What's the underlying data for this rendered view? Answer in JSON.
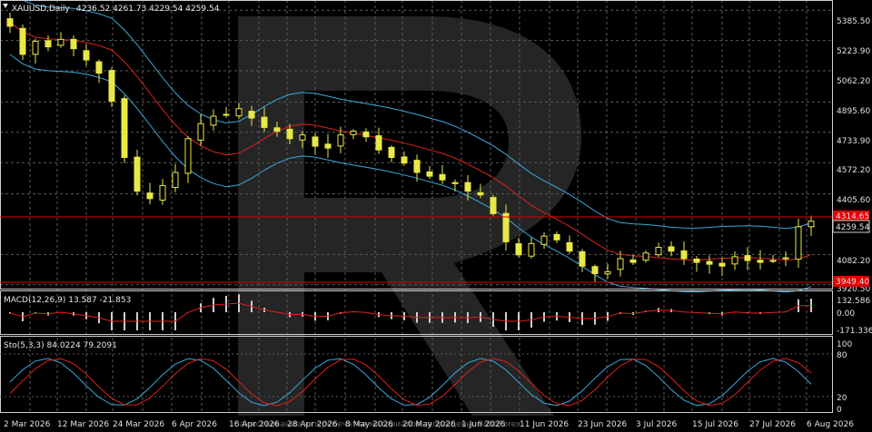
{
  "header": {
    "symbol_label": "XAUUSD,Daily",
    "ohlc": "4236.52 4261.73 4229.54 4259.54"
  },
  "colors": {
    "background": "#000000",
    "grid": "#5a5a5a",
    "bull_candle": "#000000",
    "candle": "#e8e848",
    "bollinger": "#3aa9d9",
    "ma": "#e02020",
    "hline": "#e00000",
    "macd_hist": "#cfcfcf",
    "macd_signal": "#e02020",
    "stoch_main": "#3aa9d9",
    "stoch_signal": "#e02020"
  },
  "price_panel": {
    "y_labels": [
      "5385.50",
      "5223.90",
      "5062.20",
      "4895.60",
      "4733.90",
      "4572.20",
      "4405.60",
      "4259.54",
      "4082.20",
      "3920.50"
    ],
    "current_price": "4259.54",
    "hline_upper": "4314.65",
    "hline_lower": "3949.40"
  },
  "macd_panel": {
    "label": "MACD(12,26,9) 13.587 -21.853",
    "y_labels": [
      "132.586",
      "0.00",
      "-171.336"
    ]
  },
  "stoch_panel": {
    "label": "Sto(5,3,3) 84.0224 79.2091",
    "y_labels": [
      "100",
      "80",
      "20",
      "0"
    ]
  },
  "x_axis": {
    "labels": [
      "2 Mar 2026",
      "12 Mar 2026",
      "24 Mar 2026",
      "6 Apr 2026",
      "16 Apr 2026",
      "28 Apr 2026",
      "8 May 2026",
      "20 May 2026",
      "1 Jun 2026",
      "11 Jun 2026",
      "23 Jun 2026",
      "3 Jul 2026",
      "15 Jul 2026",
      "27 Jul 2026",
      "6 Aug 2026"
    ]
  },
  "watermark": {
    "letter": "R",
    "footer_text": "Заимствование и перепечатка материалов запрещены. RoboForex"
  },
  "chart_data": {
    "type": "candlestick",
    "series": [
      {
        "name": "XAUUSD,Daily",
        "close_path": [
          5300,
          5150,
          5220,
          5190,
          5230,
          5180,
          5120,
          5050,
          4900,
          4600,
          4420,
          4380,
          4450,
          4520,
          4700,
          4780,
          4820,
          4830,
          4860,
          4810,
          4760,
          4740,
          4700,
          4720,
          4660,
          4650,
          4720,
          4740,
          4710,
          4640,
          4600,
          4570,
          4520,
          4500,
          4480,
          4460,
          4420,
          4400,
          4300,
          4150,
          4080,
          4140,
          4180,
          4160,
          4100,
          4020,
          3980,
          3990,
          4060,
          4040,
          4090,
          4120,
          4100,
          4060,
          4040,
          4030,
          4020,
          4070,
          4050,
          4040,
          4050,
          4060,
          4230,
          4259.54
        ]
      }
    ],
    "ylim": [
      3900,
      5440
    ],
    "y_ticks": [
      5385.5,
      5223.9,
      5062.2,
      4895.6,
      4733.9,
      4572.2,
      4405.6,
      4082.2,
      3920.5
    ]
  }
}
